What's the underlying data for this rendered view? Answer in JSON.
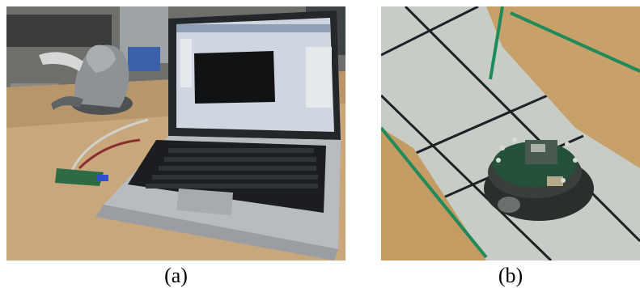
{
  "panels": [
    {
      "id": "a",
      "caption": "(a)",
      "subject": "laptop-with-haptic-device-and-circuit-board"
    },
    {
      "id": "b",
      "caption": "(b)",
      "subject": "round-mobile-robot-on-tiled-floor"
    }
  ],
  "colors": {
    "desk": "#c9a77c",
    "laptop_silver": "#b8bcc0",
    "keyboard": "#1b1d20",
    "screen_bg": "#cfd6df",
    "floor_tile": "#c8ccc6",
    "wall_board": "#c7a06a",
    "green_tape": "#1f8a5a",
    "robot_body": "#2a2e2c"
  }
}
